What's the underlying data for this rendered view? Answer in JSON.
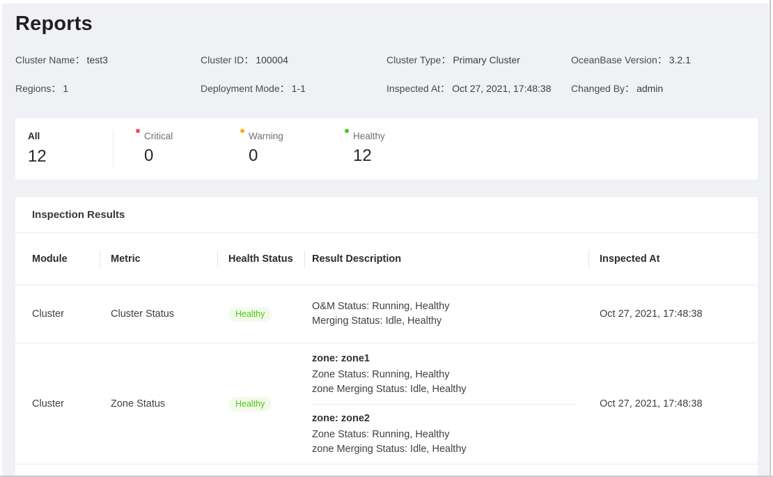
{
  "page": {
    "title": "Reports"
  },
  "cluster_info": {
    "fields": [
      {
        "label": "Cluster Name：",
        "value": "test3"
      },
      {
        "label": "Cluster ID：",
        "value": "100004"
      },
      {
        "label": "Cluster Type：",
        "value": "Primary Cluster"
      },
      {
        "label": "OceanBase Version：",
        "value": "3.2.1"
      },
      {
        "label": "Regions：",
        "value": "1"
      },
      {
        "label": "Deployment Mode：",
        "value": "1-1"
      },
      {
        "label": "Inspected At：",
        "value": "Oct 27, 2021, 17:48:38"
      },
      {
        "label": "Changed By：",
        "value": "admin"
      }
    ]
  },
  "summary": {
    "all": {
      "label": "All",
      "value": "12"
    },
    "items": [
      {
        "label": "Critical",
        "value": "0",
        "dot_color": "#f5485c"
      },
      {
        "label": "Warning",
        "value": "0",
        "dot_color": "#faad14"
      },
      {
        "label": "Healthy",
        "value": "12",
        "dot_color": "#52c41a"
      }
    ]
  },
  "results": {
    "title": "Inspection Results",
    "columns": [
      "Module",
      "Metric",
      "Health Status",
      "Result Description",
      "Inspected At"
    ],
    "health_badge": {
      "bg": "#f2fbea",
      "text": "#52c41a"
    },
    "rows": [
      {
        "module": "Cluster",
        "metric": "Cluster Status",
        "health_status": "Healthy",
        "description_blocks": [
          {
            "heading": "",
            "lines": [
              "O&M Status: Running, Healthy",
              "Merging Status: Idle, Healthy"
            ]
          }
        ],
        "inspected_at": "Oct 27, 2021, 17:48:38"
      },
      {
        "module": "Cluster",
        "metric": "Zone Status",
        "health_status": "Healthy",
        "description_blocks": [
          {
            "heading": "zone: zone1",
            "lines": [
              "Zone Status: Running, Healthy",
              "zone Merging Status: Idle, Healthy"
            ]
          },
          {
            "heading": "zone: zone2",
            "lines": [
              "Zone Status: Running, Healthy",
              "zone Merging Status: Idle, Healthy"
            ]
          }
        ],
        "inspected_at": "Oct 27, 2021, 17:48:38"
      }
    ]
  }
}
